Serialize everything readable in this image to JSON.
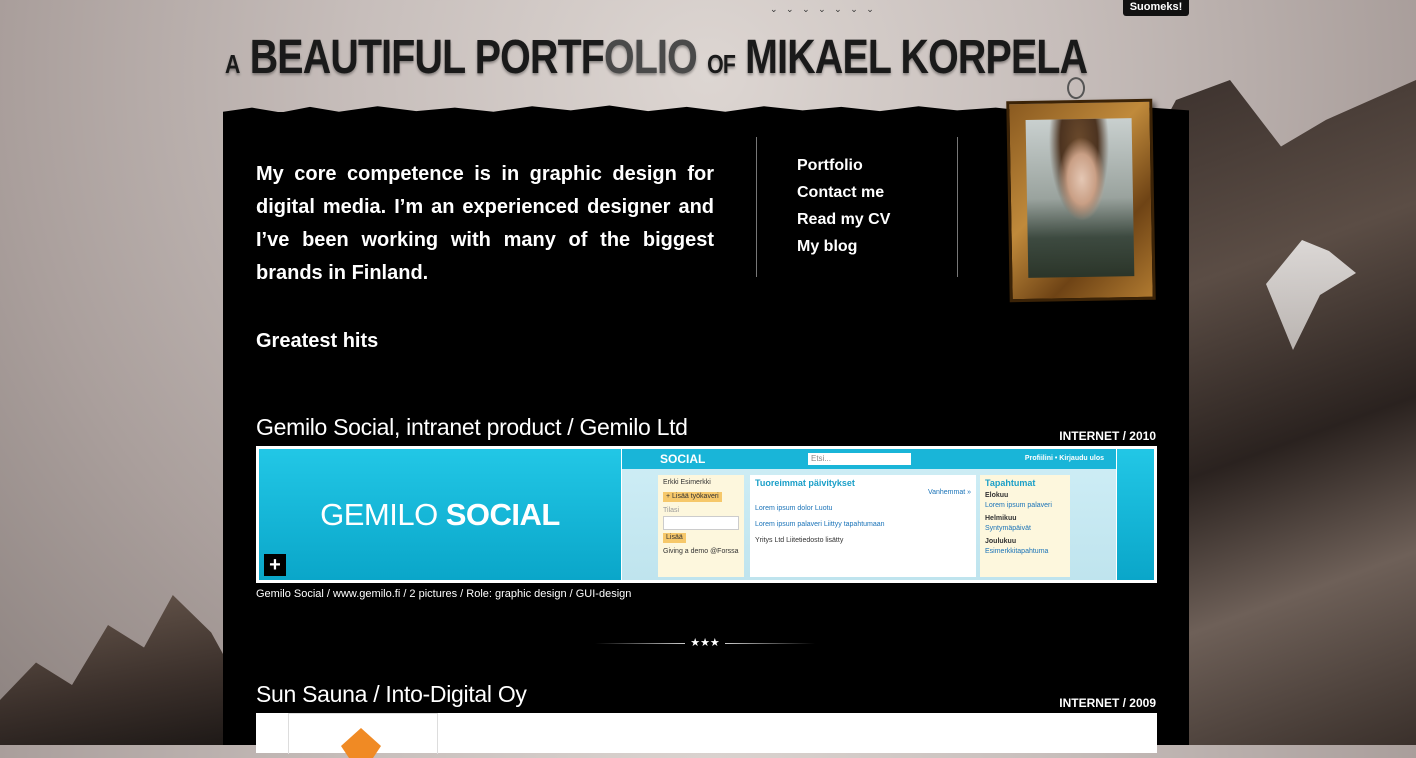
{
  "lang_switch": "Suomeks!",
  "title": {
    "part1": "A",
    "part2": "BEAUTIFUL PORTF",
    "part3": "OLIO",
    "part4": "OF",
    "part5": "MIKAEL KORPELA"
  },
  "intro": "My core competence is in graphic design for digital media. I’m an experienced designer and I’ve been working with many of the biggest brands in Finland.",
  "nav": [
    "Portfolio",
    "Contact me",
    "Read my CV",
    "My blog"
  ],
  "greatest_hits": "Greatest hits",
  "projects": [
    {
      "title": "Gemilo Social, intranet product / Gemilo Ltd",
      "meta": "INTERNET / 2010",
      "caption": "Gemilo Social / www.gemilo.fi / 2 pictures / Role: graphic design / GUI-design",
      "preview": {
        "brand_a": "GEMILO",
        "brand_b": "SOCIAL",
        "app_bar": "SOCIAL",
        "search_placeholder": "Etsi...",
        "links": "Profiilini • Kirjaudu ulos",
        "user": "Erkki Esimerkki",
        "add_friend": "+ Lisää työkaveri",
        "status_label": "Tilasi",
        "add_btn": "Lisää",
        "updates_title": "Tuoreimmat päivitykset",
        "older": "Vanhemmat »",
        "update1": "Lorem ipsum dolor Luotu",
        "update2": "Lorem ipsum palaveri Liittyy tapahtumaan",
        "update3": "Yritys Ltd Liitetiedosto lisätty",
        "events_title": "Tapahtumat",
        "month1": "Elokuu",
        "event1": "Lorem ipsum palaveri",
        "month2": "Helmikuu",
        "event2": "Syntymäpäivät",
        "month3": "Joulukuu",
        "event3": "Esimerkkitapahtuma",
        "giving": "Giving a demo @Forssa"
      }
    },
    {
      "title": "Sun Sauna / Into-Digital Oy",
      "meta": "INTERNET / 2009"
    }
  ],
  "separator": "★★★",
  "birds": "⌄ ⌄ ⌄ ⌄ ⌄ ⌄ ⌄"
}
